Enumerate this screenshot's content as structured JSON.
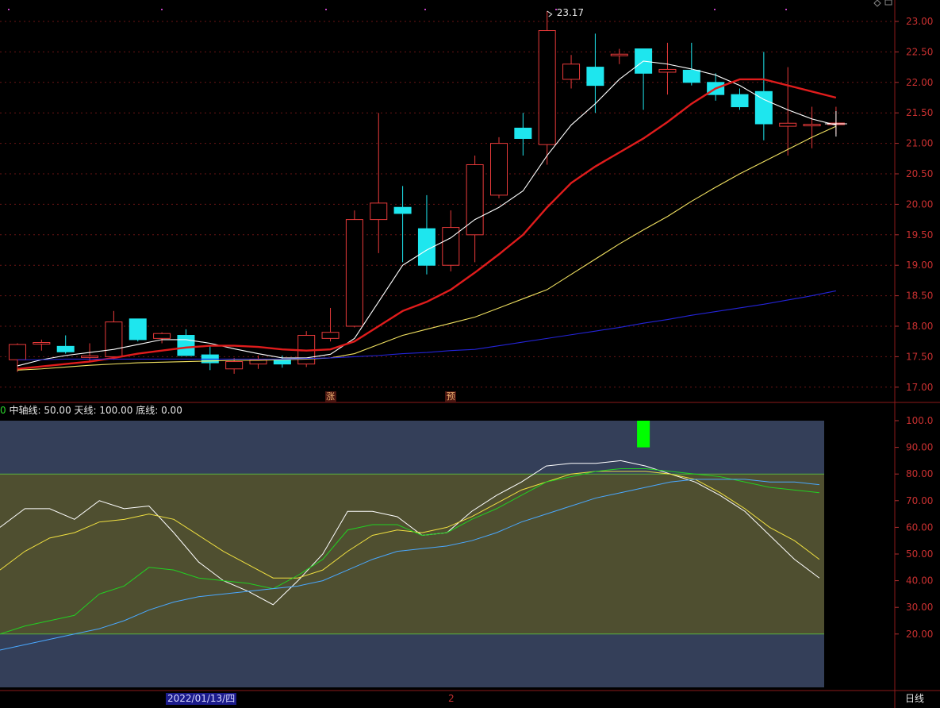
{
  "chart_data": [
    {
      "type": "candlestick",
      "y_ticks": [
        "23.00",
        "22.50",
        "22.00",
        "21.50",
        "21.00",
        "20.50",
        "20.00",
        "19.50",
        "19.00",
        "18.50",
        "18.00",
        "17.50",
        "17.00"
      ],
      "ylim": [
        16.9,
        23.3
      ],
      "candles": [
        {
          "o": 17.45,
          "h": 17.72,
          "l": 17.25,
          "c": 17.7
        },
        {
          "o": 17.72,
          "h": 17.78,
          "l": 17.6,
          "c": 17.72
        },
        {
          "o": 17.67,
          "h": 17.85,
          "l": 17.55,
          "c": 17.58
        },
        {
          "o": 17.5,
          "h": 17.72,
          "l": 17.42,
          "c": 17.5
        },
        {
          "o": 17.5,
          "h": 18.25,
          "l": 17.45,
          "c": 18.07
        },
        {
          "o": 18.12,
          "h": 18.12,
          "l": 17.75,
          "c": 17.78
        },
        {
          "o": 17.8,
          "h": 17.9,
          "l": 17.72,
          "c": 17.88
        },
        {
          "o": 17.85,
          "h": 17.95,
          "l": 17.55,
          "c": 17.52
        },
        {
          "o": 17.53,
          "h": 17.68,
          "l": 17.28,
          "c": 17.4
        },
        {
          "o": 17.3,
          "h": 17.48,
          "l": 17.22,
          "c": 17.42
        },
        {
          "o": 17.38,
          "h": 17.52,
          "l": 17.3,
          "c": 17.45
        },
        {
          "o": 17.45,
          "h": 17.52,
          "l": 17.32,
          "c": 17.38
        },
        {
          "o": 17.38,
          "h": 17.92,
          "l": 17.33,
          "c": 17.85
        },
        {
          "o": 17.8,
          "h": 18.3,
          "l": 17.75,
          "c": 17.9
        },
        {
          "o": 18.0,
          "h": 19.9,
          "l": 17.98,
          "c": 19.75
        },
        {
          "o": 19.75,
          "h": 21.5,
          "l": 19.2,
          "c": 20.02
        },
        {
          "o": 19.95,
          "h": 20.3,
          "l": 19.05,
          "c": 19.85
        },
        {
          "o": 19.6,
          "h": 20.15,
          "l": 18.85,
          "c": 19.0
        },
        {
          "o": 19.0,
          "h": 19.9,
          "l": 18.9,
          "c": 19.62
        },
        {
          "o": 19.5,
          "h": 20.8,
          "l": 19.05,
          "c": 20.65
        },
        {
          "o": 20.15,
          "h": 21.1,
          "l": 20.1,
          "c": 21.0
        },
        {
          "o": 21.25,
          "h": 21.5,
          "l": 20.8,
          "c": 21.08
        },
        {
          "o": 20.98,
          "h": 23.17,
          "l": 20.65,
          "c": 22.85
        },
        {
          "o": 22.05,
          "h": 22.45,
          "l": 21.9,
          "c": 22.3
        },
        {
          "o": 22.25,
          "h": 22.8,
          "l": 21.5,
          "c": 21.95
        },
        {
          "o": 22.45,
          "h": 22.55,
          "l": 22.3,
          "c": 22.45
        },
        {
          "o": 22.55,
          "h": 22.55,
          "l": 21.55,
          "c": 22.15
        },
        {
          "o": 22.18,
          "h": 22.65,
          "l": 21.8,
          "c": 22.2
        },
        {
          "o": 22.2,
          "h": 22.65,
          "l": 21.95,
          "c": 22.0
        },
        {
          "o": 22.0,
          "h": 22.15,
          "l": 21.7,
          "c": 21.8
        },
        {
          "o": 21.8,
          "h": 21.9,
          "l": 21.55,
          "c": 21.6
        },
        {
          "o": 21.85,
          "h": 22.5,
          "l": 21.05,
          "c": 21.32
        },
        {
          "o": 21.28,
          "h": 22.25,
          "l": 20.8,
          "c": 21.33
        },
        {
          "o": 21.3,
          "h": 21.6,
          "l": 20.92,
          "c": 21.3
        },
        {
          "o": 21.32,
          "h": 21.6,
          "l": 21.15,
          "c": 21.32
        }
      ],
      "ma_lines": [
        {
          "name": "MA5",
          "color": "#ffffff",
          "values": [
            17.35,
            17.45,
            17.52,
            17.57,
            17.62,
            17.7,
            17.78,
            17.78,
            17.72,
            17.63,
            17.55,
            17.48,
            17.48,
            17.54,
            17.8,
            18.4,
            19.0,
            19.25,
            19.45,
            19.75,
            19.95,
            20.22,
            20.8,
            21.3,
            21.65,
            22.05,
            22.35,
            22.3,
            22.22,
            22.12,
            21.95,
            21.72,
            21.55,
            21.4,
            21.3
          ]
        },
        {
          "name": "MA10",
          "color": "#e01c1c",
          "values": [
            17.3,
            17.34,
            17.38,
            17.42,
            17.48,
            17.55,
            17.6,
            17.65,
            17.68,
            17.68,
            17.66,
            17.62,
            17.6,
            17.62,
            17.75,
            18.0,
            18.25,
            18.4,
            18.6,
            18.88,
            19.18,
            19.5,
            19.95,
            20.35,
            20.62,
            20.85,
            21.08,
            21.35,
            21.65,
            21.9,
            22.05,
            22.05,
            21.95,
            21.85,
            21.75
          ]
        },
        {
          "name": "MA20",
          "color": "#f0e060",
          "values": [
            17.28,
            17.3,
            17.33,
            17.36,
            17.38,
            17.4,
            17.41,
            17.42,
            17.43,
            17.44,
            17.44,
            17.45,
            17.46,
            17.48,
            17.55,
            17.7,
            17.85,
            17.95,
            18.05,
            18.15,
            18.3,
            18.45,
            18.6,
            18.85,
            19.1,
            19.35,
            19.58,
            19.8,
            20.05,
            20.28,
            20.5,
            20.7,
            20.9,
            21.1,
            21.28
          ]
        },
        {
          "name": "MA60",
          "color": "#2424d8",
          "values": [
            17.45,
            17.45,
            17.46,
            17.46,
            17.46,
            17.46,
            17.46,
            17.46,
            17.46,
            17.46,
            17.46,
            17.46,
            17.47,
            17.48,
            17.5,
            17.52,
            17.55,
            17.57,
            17.6,
            17.62,
            17.68,
            17.74,
            17.8,
            17.86,
            17.92,
            17.98,
            18.05,
            18.11,
            18.18,
            18.24,
            18.3,
            18.36,
            18.43,
            18.5,
            18.58
          ]
        }
      ],
      "max_label": "23.17",
      "markers": [
        {
          "index": 13,
          "text": "涨"
        },
        {
          "index": 18,
          "text": "预"
        }
      ]
    },
    {
      "type": "line",
      "y_ticks": [
        "100.0",
        "90.00",
        "80.00",
        "70.00",
        "60.00",
        "50.00",
        "40.00",
        "30.00",
        "20.00"
      ],
      "ylim": [
        0,
        100
      ],
      "levels": {
        "header_prefix": "0",
        "mid_label": "中轴线:",
        "mid_value": "50.00",
        "top_label": "天线:",
        "top_value": "100.00",
        "bottom_label": "底线:",
        "bottom_value": "0.00"
      },
      "bands": [
        {
          "from": 80,
          "to": 100,
          "color": "#343f59"
        },
        {
          "from": 20,
          "to": 80,
          "color": "#4f4f30"
        },
        {
          "from": 0,
          "to": 20,
          "color": "#343f59"
        }
      ],
      "series": [
        {
          "color": "#ffffff",
          "values": [
            60,
            67,
            67,
            63,
            70,
            67,
            68,
            58,
            47,
            40,
            36,
            31,
            40,
            50,
            66,
            66,
            64,
            57,
            58,
            66,
            72,
            77,
            83,
            84,
            84,
            85,
            83,
            80,
            77,
            72,
            66,
            57,
            48,
            41
          ]
        },
        {
          "color": "#f0e040",
          "values": [
            44,
            51,
            56,
            58,
            62,
            63,
            65,
            63,
            57,
            51,
            46,
            41,
            41,
            44,
            51,
            57,
            59,
            58,
            60,
            64,
            69,
            74,
            77,
            80,
            81,
            81,
            81,
            80,
            78,
            73,
            67,
            60,
            55,
            48
          ]
        },
        {
          "color": "#22d022",
          "values": [
            20,
            23,
            25,
            27,
            35,
            38,
            45,
            44,
            41,
            40,
            39,
            37,
            42,
            48,
            59,
            61,
            61,
            57,
            58,
            63,
            67,
            72,
            77,
            79,
            81,
            82,
            82,
            81,
            80,
            79,
            77,
            75,
            74,
            73
          ]
        },
        {
          "color": "#4aa8ff",
          "values": [
            14,
            16,
            18,
            20,
            22,
            25,
            29,
            32,
            34,
            35,
            36,
            37,
            38,
            40,
            44,
            48,
            51,
            52,
            53,
            55,
            58,
            62,
            65,
            68,
            71,
            73,
            75,
            77,
            78,
            78,
            78,
            77,
            77,
            76
          ]
        }
      ],
      "signal_bar": {
        "index": 26,
        "from": 90,
        "to": 100,
        "color": "#00ff00"
      }
    }
  ],
  "x_axis": {
    "date_label": "2022/01/13/四",
    "mark_label": "2",
    "period_label": "日线"
  }
}
